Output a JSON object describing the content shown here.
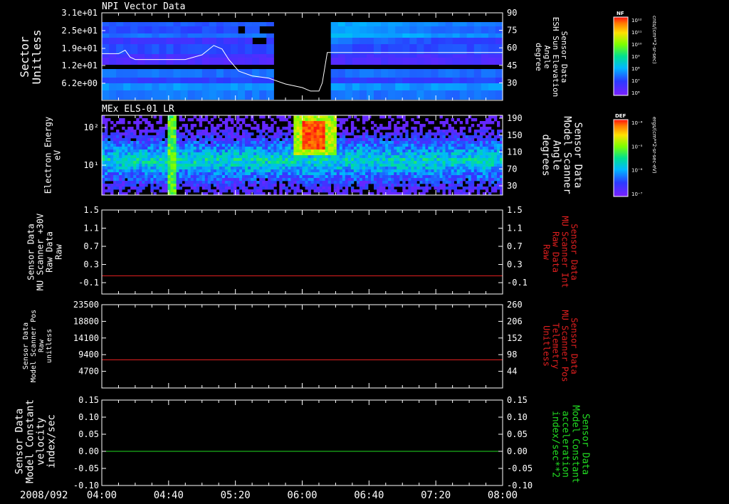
{
  "date_label": "2008/092",
  "colors": {
    "red": "#e21f1f",
    "green": "#22dd22",
    "white": "#ffffff"
  },
  "chart_data": [
    {
      "type": "heatmap",
      "title": "NPI Vector Data",
      "ylabel": "Sector\nUnitless",
      "ytick_labels": [
        "3.1e+01",
        "2.5e+01",
        "1.9e+01",
        "1.2e+01",
        "6.2e+00"
      ],
      "y2label": "Sensor Data\nESH Sun Elevation\nAngle\ndegree",
      "y2_ticks": [
        90,
        75,
        60,
        45,
        30
      ],
      "y2_range": [
        15,
        90
      ],
      "colorbar": {
        "title": "NF",
        "units": "cnts/(cm**2-sr-sec)",
        "tick_labels": [
          "10¹²",
          "10¹¹",
          "10¹⁰",
          "10⁹",
          "10⁸",
          "10⁷",
          "10⁶"
        ]
      },
      "overlay_line": {
        "times": [
          "04:00",
          "04:10",
          "04:14",
          "04:17",
          "04:20",
          "04:30",
          "04:50",
          "05:00",
          "05:07",
          "05:12",
          "05:16",
          "05:22",
          "05:30",
          "05:40",
          "05:50",
          "06:00",
          "06:05",
          "06:10",
          "06:12",
          "06:15",
          "08:00"
        ],
        "values": [
          55,
          55,
          58,
          52,
          50,
          50,
          50,
          54,
          62,
          59,
          50,
          40,
          36,
          34,
          29,
          26,
          23,
          23,
          30,
          56,
          56
        ]
      }
    },
    {
      "type": "heatmap",
      "title": "MEx ELS-01 LR",
      "ylabel": "Electron Energy\neV",
      "ytick_labels": [
        "10²",
        "10¹"
      ],
      "y2label": "Sensor Data\nModel Scanner\nAngle\ndegrees",
      "y2_ticks": [
        190,
        150,
        110,
        70,
        30
      ],
      "colorbar": {
        "title": "DEF",
        "units": "ergs/(cm**2-sr-sec-eV)",
        "tick_labels": [
          "10⁻⁴",
          "10⁻⁵",
          "10⁻⁶",
          "10⁻⁷"
        ]
      }
    },
    {
      "type": "line",
      "ylabel": "Sensor Data\nMU Scanner +30V\nRaw Data\nRaw",
      "y_ticks": [
        1.5,
        1.1,
        0.7,
        0.3,
        -0.1
      ],
      "ytick_labels": [
        "1.5",
        "1.1",
        "0.7",
        "0.3",
        "-0.1"
      ],
      "ylim": [
        -0.35,
        1.5
      ],
      "y2label": "Sensor Data\nMU Scanner Int\nRaw Data\nRaw",
      "y2tick_labels": [
        "1.5",
        "1.1",
        "0.7",
        "0.3",
        "-0.1"
      ],
      "series": [
        {
          "x": [
            "04:00",
            "08:00"
          ],
          "values": [
            0.05,
            0.05
          ],
          "color": "#e21f1f"
        }
      ]
    },
    {
      "type": "line",
      "ylabel": "Sensor Data\nModel Scanner Pos\nRaw\nunitless",
      "y_ticks": [
        23500,
        18800,
        14100,
        9400,
        4700
      ],
      "ytick_labels": [
        "23500",
        "18800",
        "14100",
        "9400",
        "4700"
      ],
      "ylim": [
        0,
        23500
      ],
      "y2label": "Sensor Data\nMU Scanner Pos\nTelemetry\nUnitless",
      "y2tick_labels": [
        "260",
        "206",
        "152",
        "98",
        "44"
      ],
      "series": [
        {
          "x": [
            "04:00",
            "08:00"
          ],
          "values": [
            7930,
            7930
          ],
          "color": "#e21f1f"
        }
      ]
    },
    {
      "type": "line",
      "ylabel": "Sensor Data\nModel Constant\nvelocity\nindex/sec",
      "y_ticks": [
        0.15,
        0.1,
        0.05,
        0.0,
        -0.05,
        -0.1
      ],
      "ytick_labels": [
        "0.15",
        "0.10",
        "0.05",
        "0.00",
        "-0.05",
        "-0.10"
      ],
      "ylim": [
        -0.1,
        0.15
      ],
      "y2label": "Sensor Data\nModel Constant\nacceleration\nindex/sec**2",
      "y2tick_labels": [
        "0.15",
        "0.10",
        "0.05",
        "0.00",
        "-0.05",
        "-0.10"
      ],
      "series": [
        {
          "x": [
            "04:00",
            "08:00"
          ],
          "values": [
            0.0,
            0.0
          ],
          "color": "#22dd22"
        }
      ]
    }
  ],
  "x_axis": {
    "tick_labels": [
      "04:00",
      "04:40",
      "05:20",
      "06:00",
      "06:40",
      "07:20",
      "08:00"
    ],
    "range": [
      "04:00",
      "08:00"
    ]
  }
}
